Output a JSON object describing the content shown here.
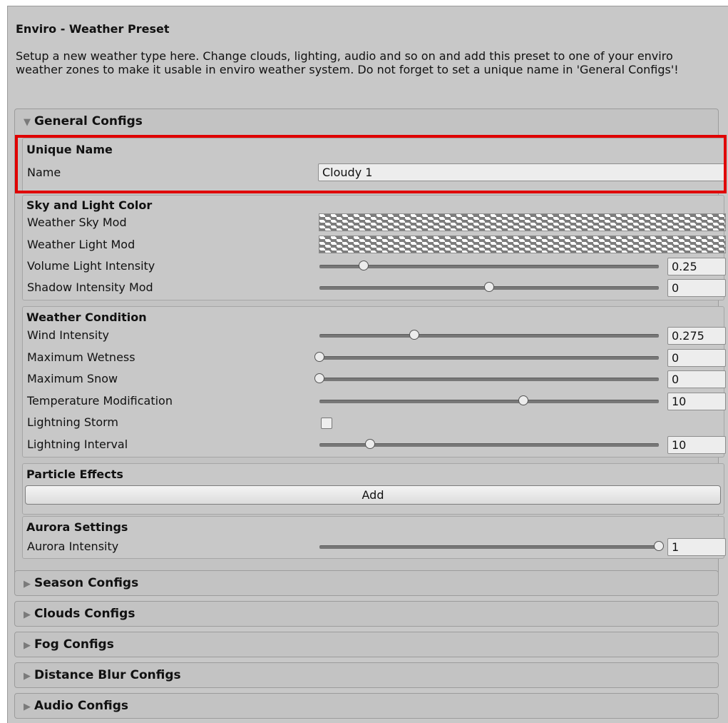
{
  "header": {
    "title": "Enviro - Weather Preset",
    "description": "Setup a new weather type here. Change clouds, lighting, audio and so on and add this preset to one of your enviro weather zones to make it usable in enviro weather system. Do not forget to set a unique name in 'General Configs'!"
  },
  "general": {
    "label": "General Configs",
    "expanded": true,
    "unique_name": {
      "title": "Unique Name",
      "name_label": "Name",
      "name_value": "Cloudy 1",
      "highlight_color": "#e00000"
    },
    "sky_light": {
      "title": "Sky and Light Color",
      "sky_mod_label": "Weather Sky Mod",
      "light_mod_label": "Weather Light Mod",
      "volume_label": "Volume Light Intensity",
      "volume_value": "0.25",
      "volume_level": 0.13,
      "shadow_label": "Shadow Intensity Mod",
      "shadow_value": "0",
      "shadow_level": 0.5
    },
    "weather_condition": {
      "title": "Weather Condition",
      "wind_label": "Wind Intensity",
      "wind_value": "0.275",
      "wind_level": 0.28,
      "wetness_label": "Maximum Wetness",
      "wetness_value": "0",
      "wetness_level": 0,
      "snow_label": "Maximum Snow",
      "snow_value": "0",
      "snow_level": 0,
      "temp_label": "Temperature Modification",
      "temp_value": "10",
      "temp_level": 0.6,
      "storm_label": "Lightning Storm",
      "storm_checked": false,
      "interval_label": "Lightning Interval",
      "interval_value": "10",
      "interval_level": 0.15
    },
    "particles": {
      "title": "Particle Effects",
      "add_label": "Add"
    },
    "aurora": {
      "title": "Aurora Settings",
      "intensity_label": "Aurora Intensity",
      "intensity_value": "1",
      "intensity_level": 1
    }
  },
  "collapsed_sections": [
    {
      "label": "Season Configs"
    },
    {
      "label": "Clouds Configs"
    },
    {
      "label": "Fog Configs"
    },
    {
      "label": "Distance Blur Configs"
    },
    {
      "label": "Audio Configs"
    }
  ]
}
